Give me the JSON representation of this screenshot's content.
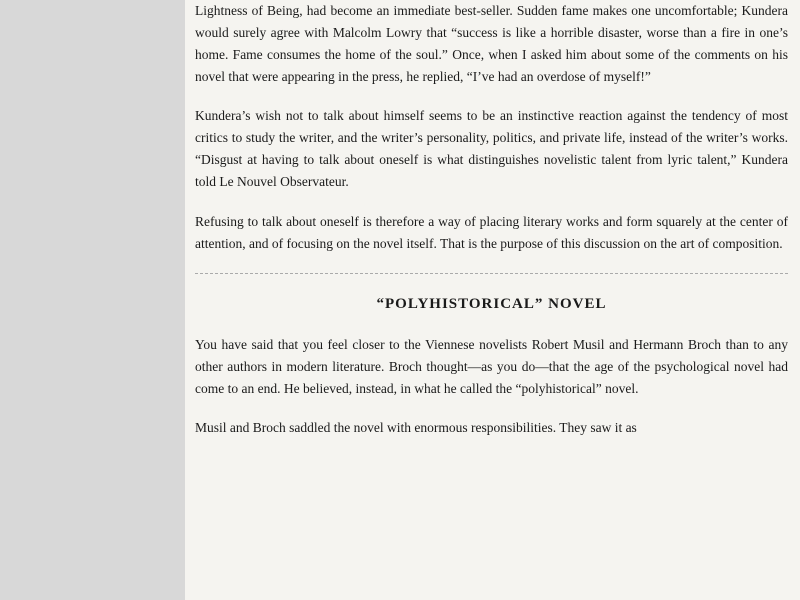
{
  "layout": {
    "background_color": "#d8d8d8",
    "content_background": "#f5f4f0"
  },
  "paragraphs": [
    {
      "id": "para1",
      "text": "Lightness of Being, had become an immediate best-seller. Sudden fame makes one uncomfortable; Kundera would surely agree with Malcolm Lowry that “success is like a horrible disaster, worse than a fire in one’s home. Fame consumes the home of the soul.” Once, when I asked him about some of the comments on his novel that were appearing in the press, he replied, “I’ve had an overdose of myself!”"
    },
    {
      "id": "para2",
      "text": "Kundera’s wish not to talk about himself seems to be an instinctive reaction against the tendency of most critics to study the writer, and the writer’s personality, politics, and private life, instead of the writer’s works. “Disgust at having to talk about oneself is what distinguishes novelistic talent from lyric talent,” Kundera told Le Nouvel Observateur."
    },
    {
      "id": "para3",
      "text": "Refusing to talk about oneself is therefore a way of placing literary works and form squarely at the center of attention, and of focusing on the novel itself. That is the purpose of this discussion on the art of composition."
    }
  ],
  "section_heading": "“POLYHISTORICAL” NOVEL",
  "lower_paragraphs": [
    {
      "id": "para4",
      "text": "You have said that you feel closer to the Viennese novelists Robert Musil and Hermann Broch than to any other authors in modern literature. Broch thought—as you do—that the age of the psychological novel had come to an end. He believed, instead, in what he called the “polyhistorical” novel."
    },
    {
      "id": "para5",
      "text": "Musil and Broch saddled the novel with enormous responsibilities. They saw it as"
    }
  ],
  "divider_style": "dashed"
}
